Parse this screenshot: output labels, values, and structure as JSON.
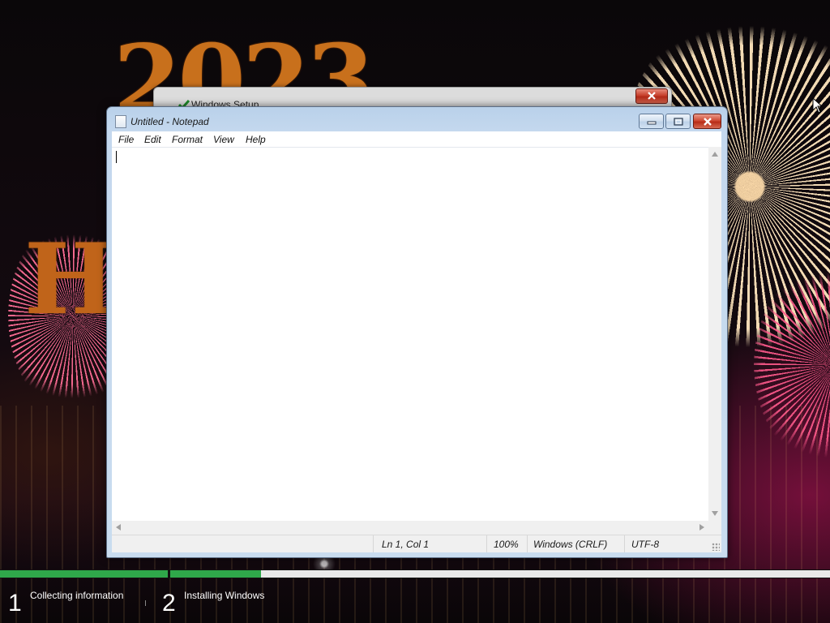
{
  "background": {
    "year_fragment": "2023",
    "h_letter": "H"
  },
  "setup_window": {
    "title": "Windows Setup"
  },
  "notepad": {
    "title": "Untitled - Notepad",
    "menu": [
      "File",
      "Edit",
      "Format",
      "View",
      "Help"
    ],
    "content": "",
    "status": {
      "position": "Ln 1, Col 1",
      "zoom": "100%",
      "line_endings": "Windows (CRLF)",
      "encoding": "UTF-8"
    }
  },
  "setup_progress": {
    "steps": [
      {
        "number": "1",
        "label": "Collecting information",
        "progress": 1.0
      },
      {
        "number": "2",
        "label": "Installing Windows",
        "progress": 0.137
      }
    ],
    "fill_color": "#2fa84a"
  }
}
